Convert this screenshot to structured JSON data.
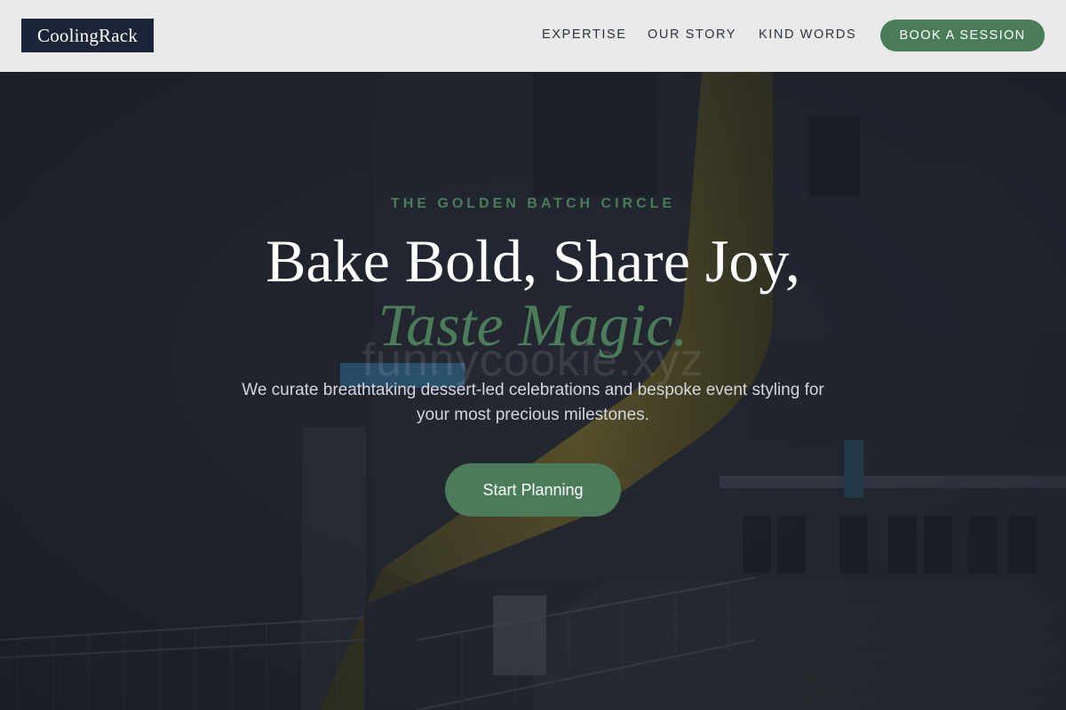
{
  "header": {
    "logo": "CoolingRack",
    "nav": {
      "expertise": "EXPERTISE",
      "story": "OUR STORY",
      "kind_words": "KIND WORDS"
    },
    "cta": "BOOK A SESSION"
  },
  "hero": {
    "eyebrow": "THE GOLDEN BATCH CIRCLE",
    "headline": "Bake Bold, Share Joy,",
    "headline_accent": "Taste Magic.",
    "watermark": "funnycookie.xyz",
    "subtitle": "We curate breathtaking dessert-led celebrations and bespoke event styling for your most precious milestones.",
    "cta": "Start Planning",
    "background_image": "industrial-interior-with-yellow-slide"
  },
  "colors": {
    "accent": "#4a7c59",
    "logo_bg": "#1c2538",
    "header_bg": "#e9e9e9",
    "hero_overlay": "#1f232c"
  }
}
